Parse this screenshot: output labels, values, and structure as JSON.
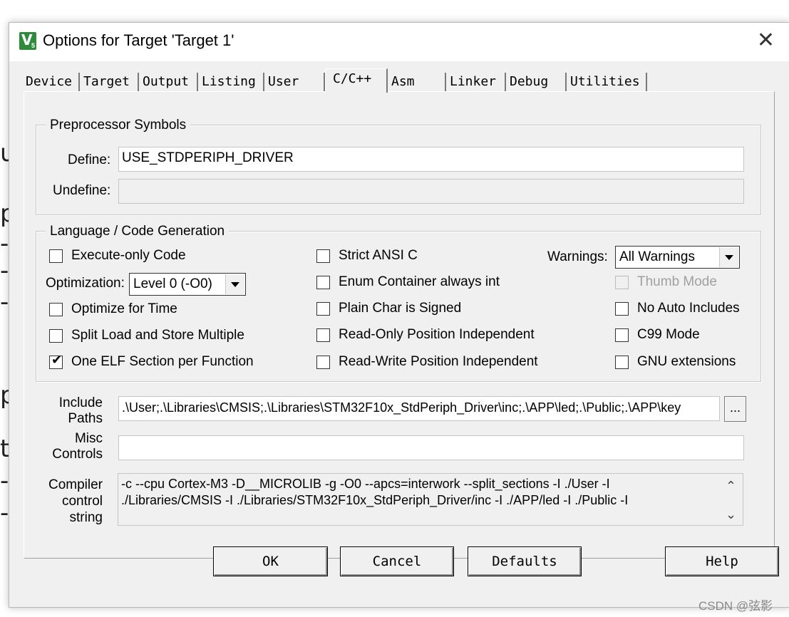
{
  "window": {
    "title": "Options for Target 'Target 1'",
    "app_icon_letters": "V",
    "app_icon_sub": "5"
  },
  "tabs": [
    {
      "label": "Device"
    },
    {
      "label": "Target"
    },
    {
      "label": "Output"
    },
    {
      "label": "Listing"
    },
    {
      "label": "User"
    },
    {
      "label": "C/C++"
    },
    {
      "label": "Asm"
    },
    {
      "label": "Linker"
    },
    {
      "label": "Debug"
    },
    {
      "label": "Utilities"
    }
  ],
  "active_tab": "C/C++",
  "preprocessor": {
    "legend": "Preprocessor Symbols",
    "define_label": "Define:",
    "define_value": "USE_STDPERIPH_DRIVER",
    "undefine_label": "Undefine:",
    "undefine_value": ""
  },
  "codegen": {
    "legend": "Language / Code Generation",
    "execute_only": {
      "label": "Execute-only Code",
      "checked": false
    },
    "optimization_label": "Optimization:",
    "optimization_value": "Level 0 (-O0)",
    "optimize_time": {
      "label": "Optimize for Time",
      "checked": false
    },
    "split_load": {
      "label": "Split Load and Store Multiple",
      "checked": false
    },
    "one_elf": {
      "label": "One ELF Section per Function",
      "checked": true
    },
    "strict_ansi": {
      "label": "Strict ANSI C",
      "checked": false
    },
    "enum_int": {
      "label": "Enum Container always int",
      "checked": false
    },
    "plain_char": {
      "label": "Plain Char is Signed",
      "checked": false
    },
    "ro_pos": {
      "label": "Read-Only Position Independent",
      "checked": false
    },
    "rw_pos": {
      "label": "Read-Write Position Independent",
      "checked": false
    },
    "warnings_label": "Warnings:",
    "warnings_value": "All Warnings",
    "thumb_mode": {
      "label": "Thumb Mode",
      "checked": false,
      "disabled": true
    },
    "no_auto_includes": {
      "label": "No Auto Includes",
      "checked": false
    },
    "c99": {
      "label": "C99 Mode",
      "checked": false
    },
    "gnu_ext": {
      "label": "GNU extensions",
      "checked": false
    }
  },
  "include": {
    "label_line1": "Include",
    "label_line2": "Paths",
    "value": ".\\User;.\\Libraries\\CMSIS;.\\Libraries\\STM32F10x_StdPeriph_Driver\\inc;.\\APP\\led;.\\Public;.\\APP\\key",
    "browse_label": "..."
  },
  "misc": {
    "label_line1": "Misc",
    "label_line2": "Controls",
    "value": ""
  },
  "compiler": {
    "label_line1": "Compiler",
    "label_line2": "control",
    "label_line3": "string",
    "line1": "-c --cpu Cortex-M3 -D__MICROLIB -g -O0 --apcs=interwork --split_sections -I ./User -I",
    "line2": "./Libraries/CMSIS -I ./Libraries/STM32F10x_StdPeriph_Driver/inc -I ./APP/led -I ./Public -I"
  },
  "buttons": {
    "ok": "OK",
    "cancel": "Cancel",
    "defaults": "Defaults",
    "help": "Help"
  },
  "watermark": "CSDN @弦影",
  "background_glyphs": [
    "u",
    "p",
    "-",
    "-",
    "-",
    "p",
    "t",
    "-",
    "-"
  ]
}
